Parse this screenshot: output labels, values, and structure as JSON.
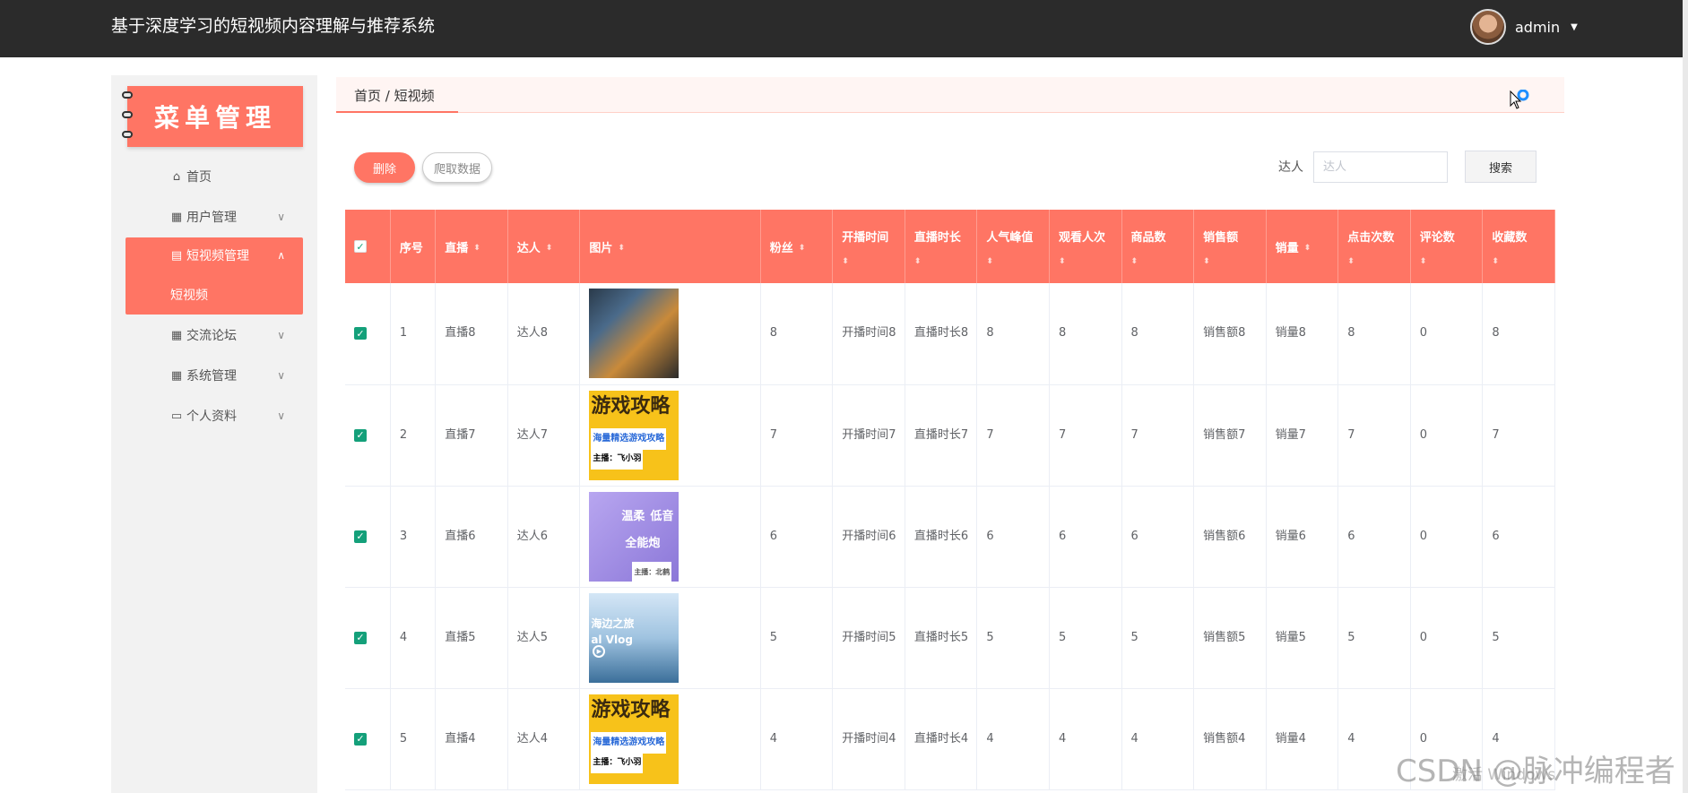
{
  "header": {
    "title": "基于深度学习的短视频内容理解与推荐系统",
    "user": "admin"
  },
  "sidebar": {
    "banner": "菜单管理",
    "items": [
      {
        "label": "首页",
        "icon": "home-icon"
      },
      {
        "label": "用户管理",
        "icon": "grid-icon"
      },
      {
        "label": "短视频管理",
        "icon": "clipboard-icon",
        "sub": "短视频"
      },
      {
        "label": "交流论坛",
        "icon": "grid-icon"
      },
      {
        "label": "系统管理",
        "icon": "grid-icon"
      },
      {
        "label": "个人资料",
        "icon": "card-icon"
      }
    ]
  },
  "breadcrumb": "首页 / 短视频",
  "toolbar": {
    "delete_label": "删除",
    "crawl_label": "爬取数据",
    "search_label": "达人",
    "search_placeholder": "达人",
    "search_button": "搜索"
  },
  "table": {
    "columns": [
      "序号",
      "直播",
      "达人",
      "图片",
      "粉丝",
      "开播时间",
      "直播时长",
      "人气峰值",
      "观看人次",
      "商品数",
      "销售额",
      "销量",
      "点击次数",
      "评论数",
      "收藏数"
    ],
    "rows": [
      {
        "idx": "1",
        "live": "直播8",
        "talent": "达人8",
        "fans": "8",
        "start_time": "开播时间8",
        "duration": "直播时长8",
        "peak": "8",
        "views": "8",
        "goods": "8",
        "sales_amount": "销售额8",
        "sales": "销量8",
        "clicks": "8",
        "comments": "0",
        "favorites": "8"
      },
      {
        "idx": "2",
        "live": "直播7",
        "talent": "达人7",
        "fans": "7",
        "start_time": "开播时间7",
        "duration": "直播时长7",
        "peak": "7",
        "views": "7",
        "goods": "7",
        "sales_amount": "销售额7",
        "sales": "销量7",
        "clicks": "7",
        "comments": "0",
        "favorites": "7"
      },
      {
        "idx": "3",
        "live": "直播6",
        "talent": "达人6",
        "fans": "6",
        "start_time": "开播时间6",
        "duration": "直播时长6",
        "peak": "6",
        "views": "6",
        "goods": "6",
        "sales_amount": "销售额6",
        "sales": "销量6",
        "clicks": "6",
        "comments": "0",
        "favorites": "6"
      },
      {
        "idx": "4",
        "live": "直播5",
        "talent": "达人5",
        "fans": "5",
        "start_time": "开播时间5",
        "duration": "直播时长5",
        "peak": "5",
        "views": "5",
        "goods": "5",
        "sales_amount": "销售额5",
        "sales": "销量5",
        "clicks": "5",
        "comments": "0",
        "favorites": "5"
      },
      {
        "idx": "5",
        "live": "直播4",
        "talent": "达人4",
        "fans": "4",
        "start_time": "开播时间4",
        "duration": "直播时长4",
        "peak": "4",
        "views": "4",
        "goods": "4",
        "sales_amount": "销售额4",
        "sales": "销量4",
        "clicks": "4",
        "comments": "0",
        "favorites": "4"
      }
    ]
  },
  "thumbnails": {
    "game_guide": "游戏攻略",
    "game_sub": "海量精选游戏攻略",
    "game_host": "主播：飞小羽",
    "voice_1": "温柔",
    "voice_2": "低音",
    "voice_3": "全能炮",
    "voice_host": "主播：北鹤",
    "travel_1": "海边之旅",
    "travel_2": "al Vlog"
  },
  "watermark": "CSDN @脉冲编程者",
  "activate_windows": "激活 Windows",
  "colors": {
    "accent": "#ff7564",
    "topbar": "#2b2b2b",
    "checkbox": "#14a07a"
  }
}
